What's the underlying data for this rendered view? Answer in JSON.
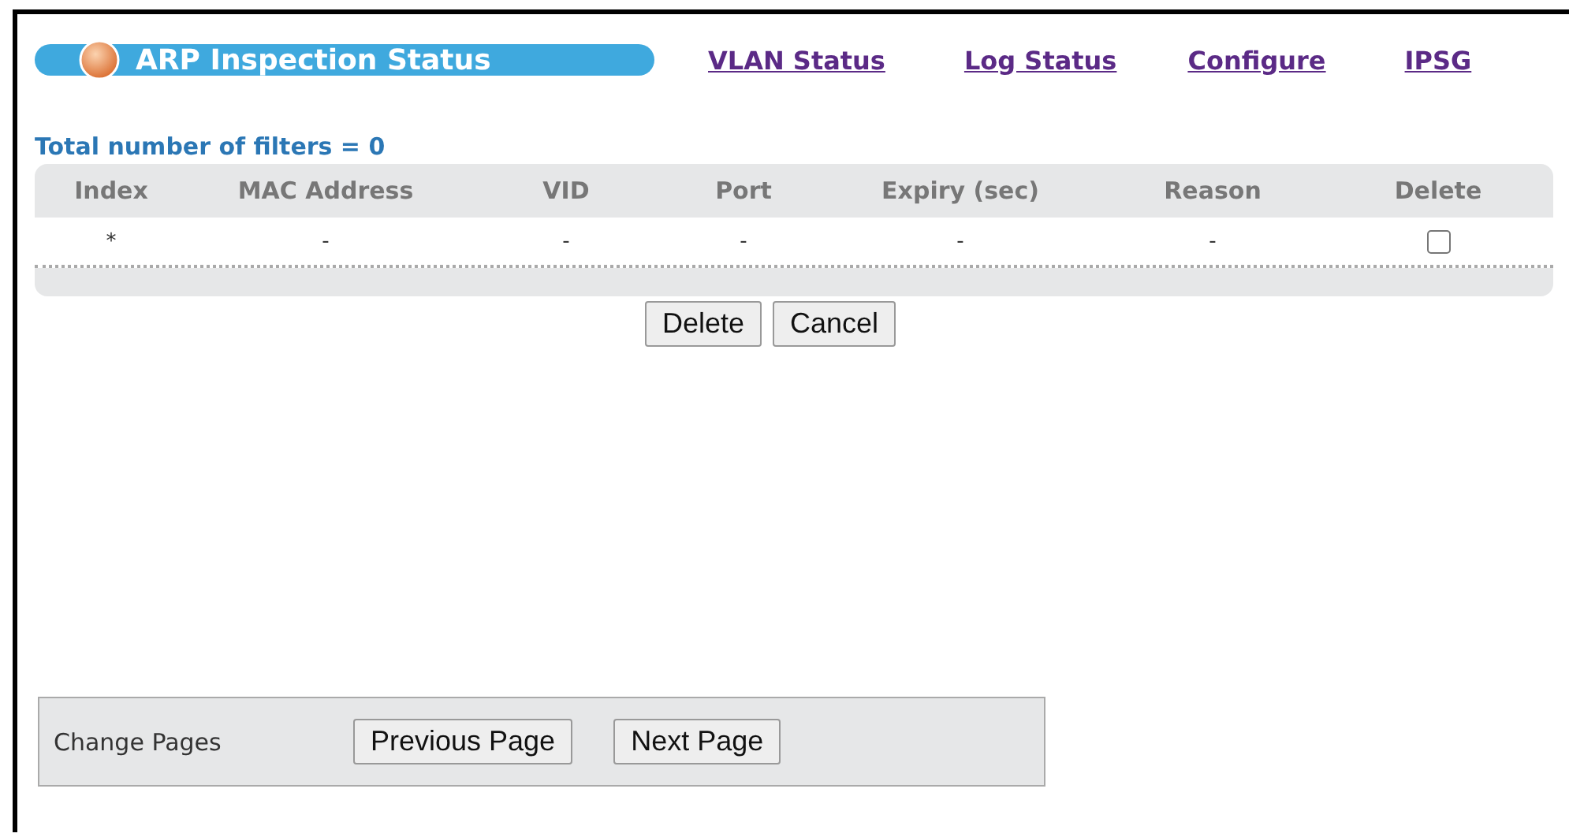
{
  "header": {
    "title": "ARP Inspection Status",
    "links": [
      "VLAN Status",
      "Log Status",
      "Configure",
      "IPSG"
    ]
  },
  "summary": "Total number of filters = 0",
  "table": {
    "columns": [
      "Index",
      "MAC Address",
      "VID",
      "Port",
      "Expiry (sec)",
      "Reason",
      "Delete"
    ],
    "rows": [
      {
        "cells": [
          "*",
          "-",
          "-",
          "-",
          "-",
          "-"
        ],
        "checked": false
      }
    ]
  },
  "actions": [
    "Delete",
    "Cancel"
  ],
  "pager": {
    "label": "Change Pages",
    "buttons": [
      "Previous Page",
      "Next Page"
    ]
  }
}
